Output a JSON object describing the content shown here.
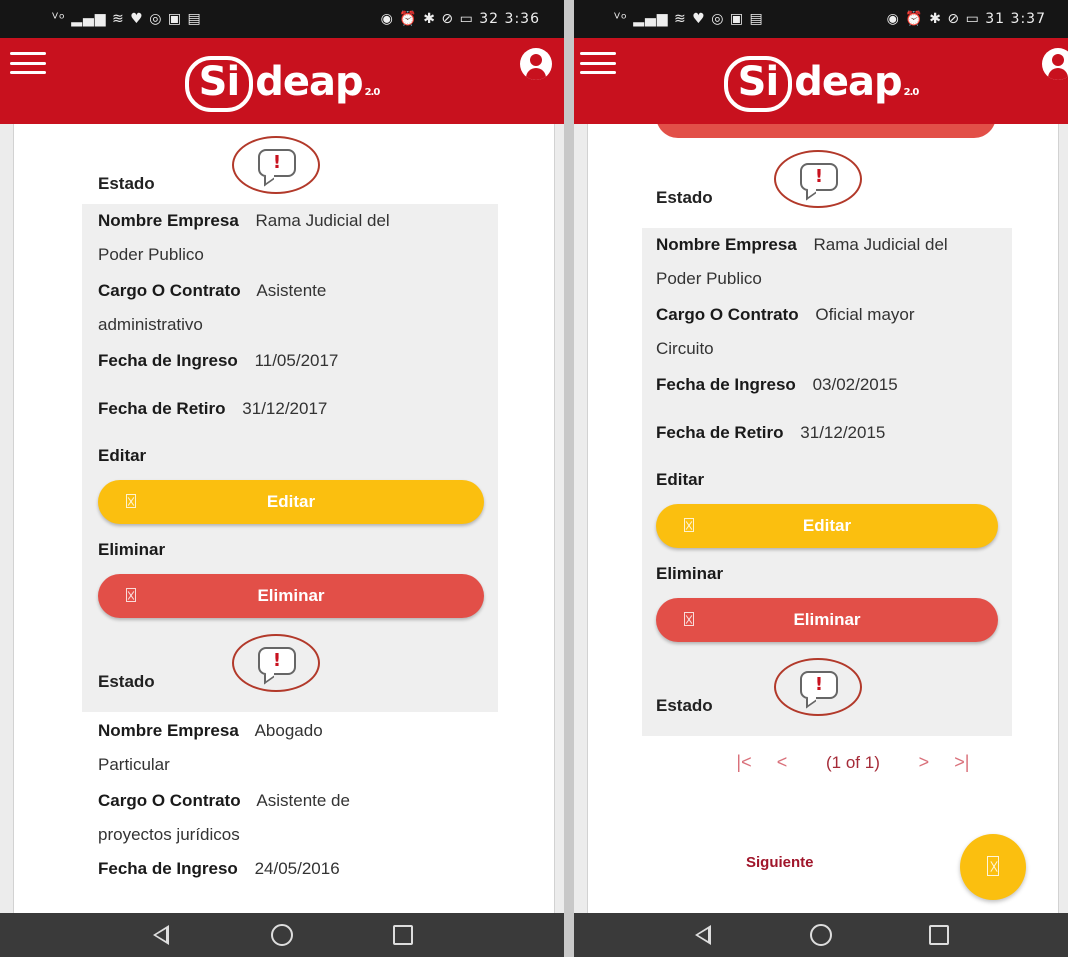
{
  "left": {
    "status": {
      "left_icons": "ⱽᵒ ▂▄▆ ≋ ♥ ◎ ▣ ▤",
      "right_icons": "◉ ⏰ ✱ ⊘ ▭",
      "battery": "32",
      "time": "3:36"
    },
    "header": {
      "logo_mark": "Si",
      "logo_rest": "deap",
      "logo_version": "2.0"
    },
    "estado_label": "Estado",
    "alert_glyph": "!",
    "records": [
      {
        "nombre_label": "Nombre Empresa",
        "nombre_value_1": "Rama Judicial del",
        "nombre_value_2": "Poder Publico",
        "cargo_label": "Cargo O Contrato",
        "cargo_value_1": "Asistente",
        "cargo_value_2": "administrativo",
        "ingreso_label": "Fecha de Ingreso",
        "ingreso_value": "11/05/2017",
        "retiro_label": "Fecha de Retiro",
        "retiro_value": "31/12/2017",
        "editar_label": "Editar",
        "editar_button": "Editar",
        "eliminar_label": "Eliminar",
        "eliminar_button": "Eliminar"
      },
      {
        "nombre_label": "Nombre Empresa",
        "nombre_value_1": "Abogado",
        "nombre_value_2": "Particular",
        "cargo_label": "Cargo O Contrato",
        "cargo_value_1": "Asistente de",
        "cargo_value_2": "proyectos jurídicos",
        "ingreso_label": "Fecha de Ingreso",
        "ingreso_value": "24/05/2016"
      }
    ]
  },
  "right": {
    "status": {
      "left_icons": "ⱽᵒ ▂▄▆ ≋ ♥ ◎ ▣ ▤",
      "right_icons": "◉ ⏰ ✱ ⊘ ▭",
      "battery": "31",
      "time": "3:37"
    },
    "header": {
      "logo_mark": "Si",
      "logo_rest": "deap",
      "logo_version": "2.0"
    },
    "estado_label": "Estado",
    "alert_glyph": "!",
    "record": {
      "nombre_label": "Nombre Empresa",
      "nombre_value_1": "Rama Judicial del",
      "nombre_value_2": "Poder Publico",
      "cargo_label": "Cargo O Contrato",
      "cargo_value_1": "Oficial mayor",
      "cargo_value_2": "Circuito",
      "ingreso_label": "Fecha de Ingreso",
      "ingreso_value": "03/02/2015",
      "retiro_label": "Fecha de Retiro",
      "retiro_value": "31/12/2015",
      "editar_label": "Editar",
      "editar_button": "Editar",
      "eliminar_label": "Eliminar",
      "eliminar_button": "Eliminar"
    },
    "pager": {
      "first": "|<",
      "prev": "<",
      "text": "(1 of 1)",
      "next": ">",
      "last": ">|"
    },
    "siguiente": "Siguiente"
  },
  "colors": {
    "brand_red": "#c8111e",
    "edit_yellow": "#fbbf0f",
    "delete_red": "#e24f48",
    "fab_yellow": "#fbbf0f"
  }
}
